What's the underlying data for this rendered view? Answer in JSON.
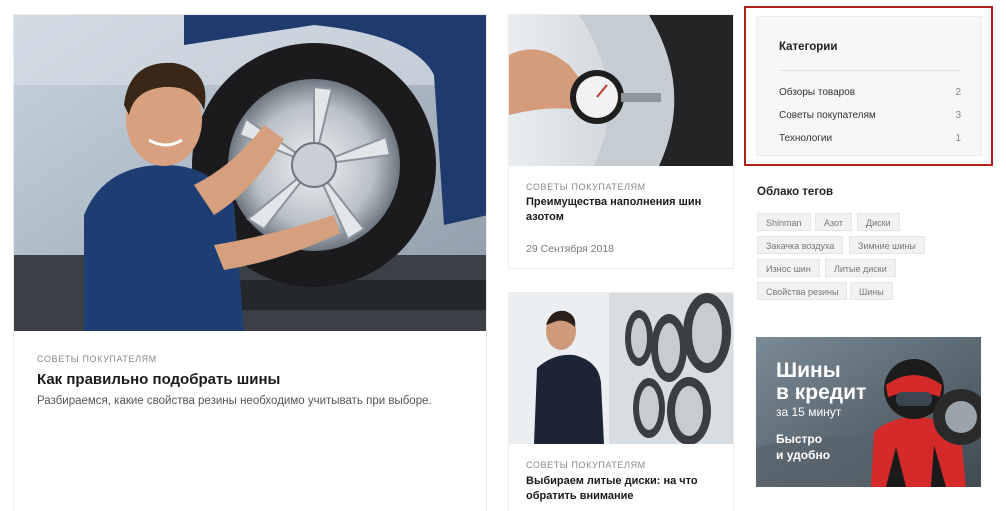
{
  "posts": [
    {
      "category": "СОВЕТЫ ПОКУПАТЕЛЯМ",
      "title": "Как правильно подобрать шины",
      "description": "Разбираемся, какие свойства резины необходимо учитывать при выборе."
    },
    {
      "category": "СОВЕТЫ ПОКУПАТЕЛЯМ",
      "title": "Преимущества наполнения шин азотом",
      "date": "29 Сентября 2018"
    },
    {
      "category": "СОВЕТЫ ПОКУПАТЕЛЯМ",
      "title": "Выбираем литые диски: на что обратить внимание"
    }
  ],
  "categories": {
    "title": "Категории",
    "items": [
      {
        "label": "Обзоры товаров",
        "count": "2"
      },
      {
        "label": "Советы покупателям",
        "count": "3"
      },
      {
        "label": "Технологии",
        "count": "1"
      }
    ]
  },
  "tag_cloud": {
    "title": "Облако тегов",
    "tags": [
      "Shinman",
      "Азот",
      "Диски",
      "Закачка воздуха",
      "Зимние шины",
      "Износ шин",
      "Литые диски",
      "Свойства резины",
      "Шины"
    ]
  },
  "banner": {
    "line1": "Шины",
    "line2": "в кредит",
    "line3": "за 15 минут",
    "line4": "Быстро",
    "line5": "и удобно"
  },
  "colors": {
    "accent_red": "#b31e1e",
    "banner_red": "#d42a2a"
  }
}
